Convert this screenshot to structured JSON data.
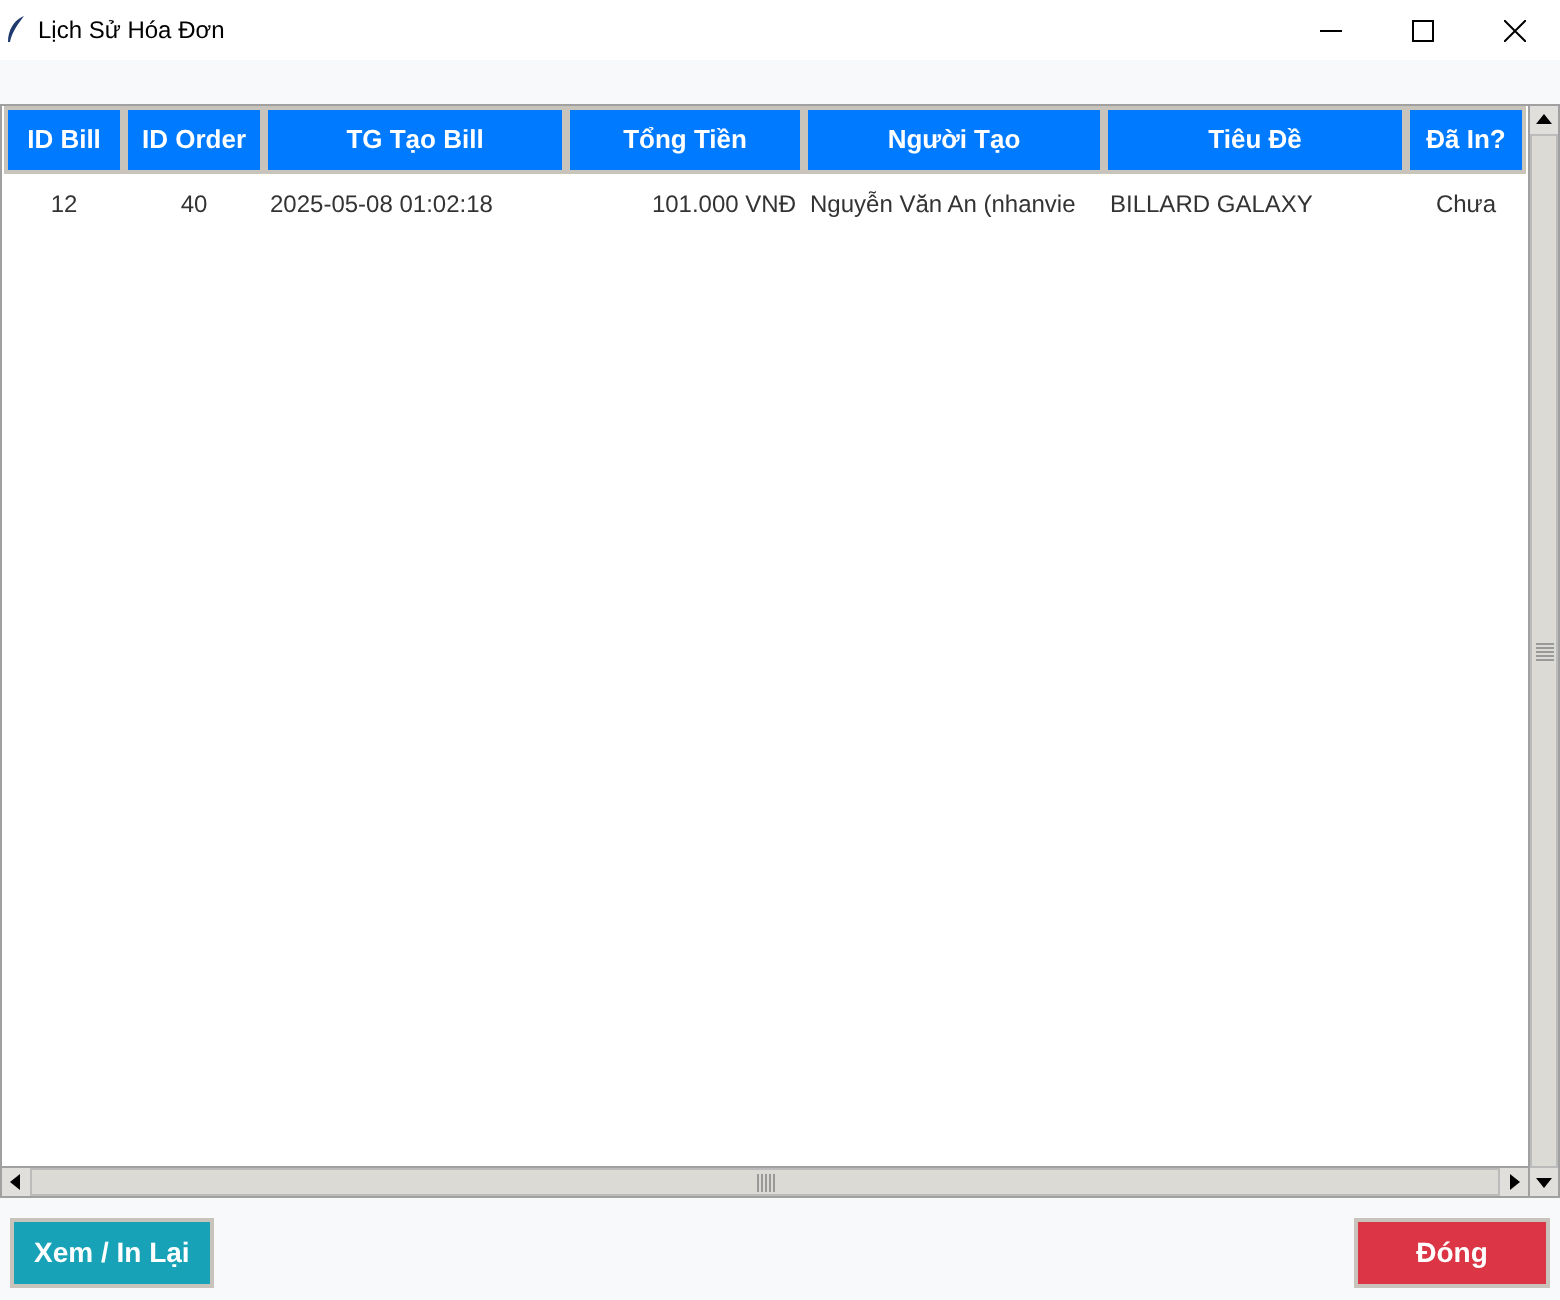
{
  "window": {
    "title": "Lịch Sử Hóa Đơn"
  },
  "table": {
    "columns": [
      "ID Bill",
      "ID Order",
      "TG Tạo Bill",
      "Tổng Tiền",
      "Người Tạo",
      "Tiêu Đề",
      "Đã In?"
    ],
    "rows": [
      [
        "12",
        "40",
        "2025-05-08 01:02:18",
        "101.000 VNĐ",
        "Nguyễn Văn An (nhanvie",
        "BILLARD GALAXY",
        "Chưa"
      ]
    ]
  },
  "buttons": [
    {
      "label": "Xem / In Lại",
      "kind": "primary"
    },
    {
      "label": "Đóng",
      "kind": "danger"
    }
  ]
}
